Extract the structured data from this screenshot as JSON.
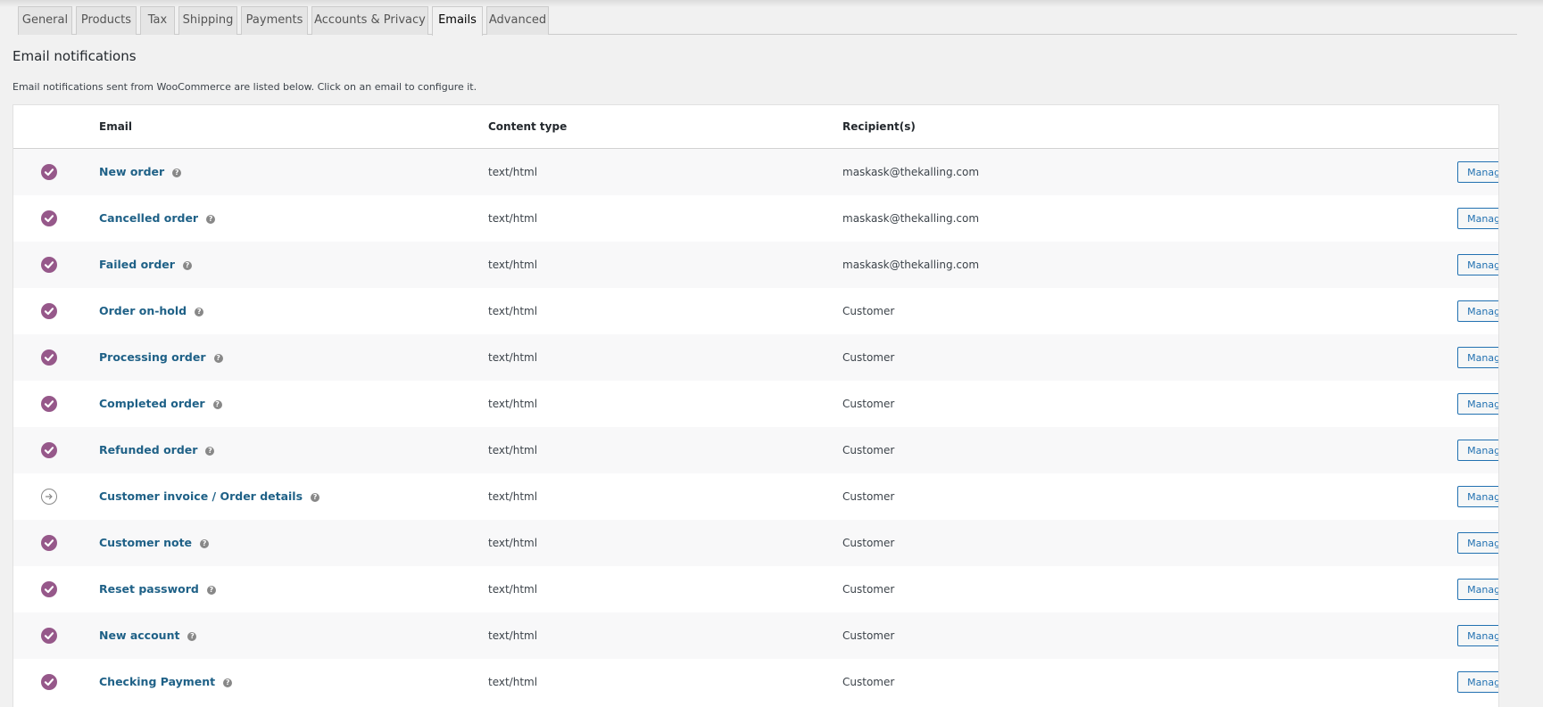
{
  "tabs": [
    {
      "label": "General",
      "active": false
    },
    {
      "label": "Products",
      "active": false
    },
    {
      "label": "Tax",
      "active": false
    },
    {
      "label": "Shipping",
      "active": false
    },
    {
      "label": "Payments",
      "active": false
    },
    {
      "label": "Accounts & Privacy",
      "active": false
    },
    {
      "label": "Emails",
      "active": true
    },
    {
      "label": "Advanced",
      "active": false
    }
  ],
  "section": {
    "title": "Email notifications",
    "description": "Email notifications sent from WooCommerce are listed below. Click on an email to configure it."
  },
  "table": {
    "headers": {
      "email": "Email",
      "content_type": "Content type",
      "recipients": "Recipient(s)"
    },
    "rows": [
      {
        "status": "enabled",
        "email": "New order",
        "content_type": "text/html",
        "recipient": "maskask@thekalling.com",
        "action": "Manage"
      },
      {
        "status": "enabled",
        "email": "Cancelled order",
        "content_type": "text/html",
        "recipient": "maskask@thekalling.com",
        "action": "Manage"
      },
      {
        "status": "enabled",
        "email": "Failed order",
        "content_type": "text/html",
        "recipient": "maskask@thekalling.com",
        "action": "Manage"
      },
      {
        "status": "enabled",
        "email": "Order on-hold",
        "content_type": "text/html",
        "recipient": "Customer",
        "action": "Manage"
      },
      {
        "status": "enabled",
        "email": "Processing order",
        "content_type": "text/html",
        "recipient": "Customer",
        "action": "Manage"
      },
      {
        "status": "enabled",
        "email": "Completed order",
        "content_type": "text/html",
        "recipient": "Customer",
        "action": "Manage"
      },
      {
        "status": "enabled",
        "email": "Refunded order",
        "content_type": "text/html",
        "recipient": "Customer",
        "action": "Manage"
      },
      {
        "status": "manual",
        "email": "Customer invoice / Order details",
        "content_type": "text/html",
        "recipient": "Customer",
        "action": "Manage"
      },
      {
        "status": "enabled",
        "email": "Customer note",
        "content_type": "text/html",
        "recipient": "Customer",
        "action": "Manage"
      },
      {
        "status": "enabled",
        "email": "Reset password",
        "content_type": "text/html",
        "recipient": "Customer",
        "action": "Manage"
      },
      {
        "status": "enabled",
        "email": "New account",
        "content_type": "text/html",
        "recipient": "Customer",
        "action": "Manage"
      },
      {
        "status": "enabled",
        "email": "Checking Payment",
        "content_type": "text/html",
        "recipient": "Customer",
        "action": "Manage"
      }
    ]
  },
  "icons": {
    "enabled": "check-circle-icon",
    "manual": "arrow-right-circle-icon",
    "help": "question-mark-icon"
  },
  "colors": {
    "accent": "#96588a",
    "link": "#1f6187",
    "button": "#2271b1",
    "background": "#f1f1f1"
  },
  "help_glyph": "?"
}
